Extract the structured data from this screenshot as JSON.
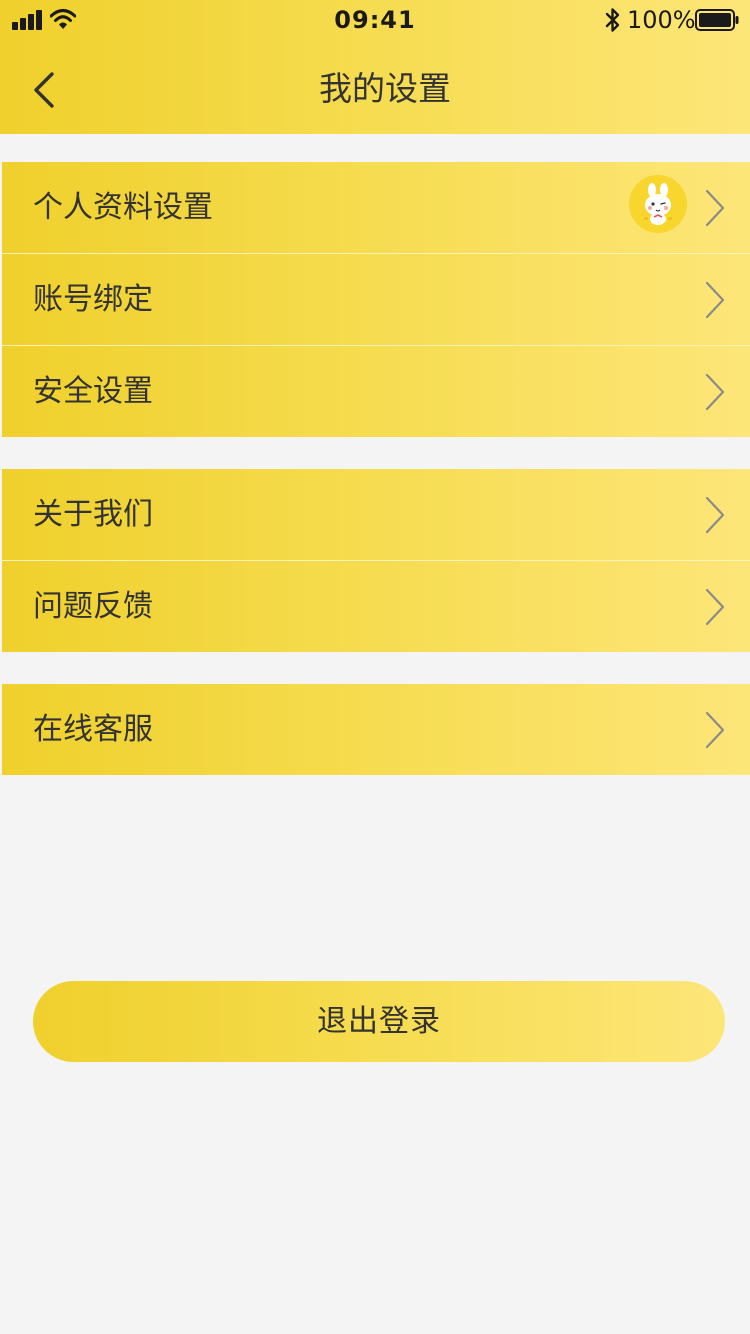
{
  "status_bar": {
    "time": "09:41",
    "battery_percent": "100%",
    "signal_icon": "signal-icon",
    "wifi_icon": "wifi-icon",
    "bluetooth_icon": "bluetooth-icon",
    "battery_icon": "battery-icon"
  },
  "header": {
    "title": "我的设置",
    "back_icon": "back-chevron-icon"
  },
  "groups": [
    {
      "items": [
        {
          "label": "个人资料设置",
          "has_avatar": true
        },
        {
          "label": "账号绑定"
        },
        {
          "label": "安全设置"
        }
      ]
    },
    {
      "items": [
        {
          "label": "关于我们"
        },
        {
          "label": "问题反馈"
        }
      ]
    },
    {
      "items": [
        {
          "label": "在线客服"
        }
      ]
    }
  ],
  "logout": {
    "label": "退出登录"
  },
  "colors": {
    "accent_start": "#efd02c",
    "accent_end": "#fde679",
    "background": "#f4f4f4",
    "text": "#333333"
  }
}
